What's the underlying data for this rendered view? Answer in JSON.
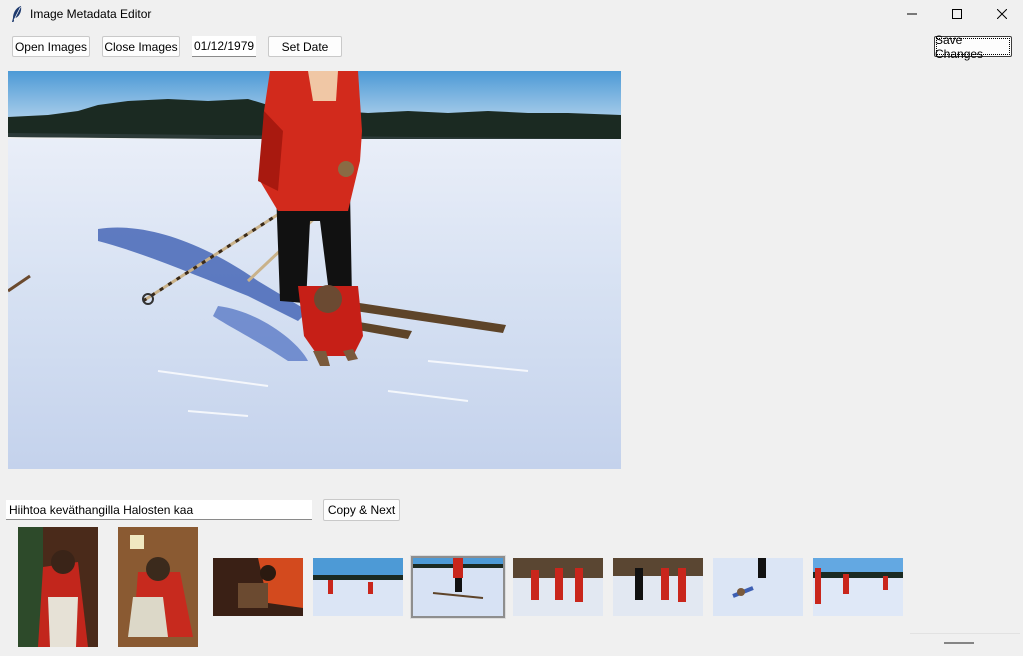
{
  "window": {
    "title": "Image Metadata Editor",
    "controls": {
      "minimize": "minimize-icon",
      "maximize": "maximize-icon",
      "close": "close-icon"
    }
  },
  "toolbar": {
    "open_label": "Open Images",
    "close_label": "Close Images",
    "date_value": "01/12/1979",
    "set_date_label": "Set Date",
    "save_label": "Save Changes"
  },
  "caption": {
    "value": "Hiihtoa keväthangilla Halosten kaa",
    "copy_next_label": "Copy & Next"
  },
  "thumbnails": [
    {
      "name": "thumb-1",
      "selected": false
    },
    {
      "name": "thumb-2",
      "selected": false
    },
    {
      "name": "thumb-3",
      "selected": false
    },
    {
      "name": "thumb-4",
      "selected": false
    },
    {
      "name": "thumb-5",
      "selected": true
    },
    {
      "name": "thumb-6",
      "selected": false
    },
    {
      "name": "thumb-7",
      "selected": false
    },
    {
      "name": "thumb-8",
      "selected": false
    },
    {
      "name": "thumb-9",
      "selected": false
    }
  ],
  "colors": {
    "window_bg": "#f0f0f0",
    "sky": "#5fa8e0",
    "snow": "#dfe8f7",
    "jacket_red": "#d22a1c",
    "tree_line": "#1b2a22"
  }
}
